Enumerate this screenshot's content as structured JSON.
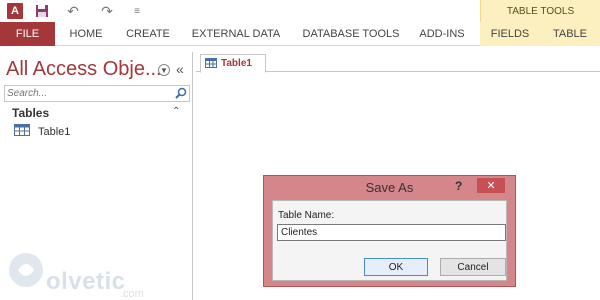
{
  "quick_access": {
    "app_icon_letter": "A",
    "undo_glyph": "↶",
    "redo_glyph": "↷",
    "customize_glyph": "≡"
  },
  "contextual_group": {
    "label": "TABLE TOOLS"
  },
  "ribbon": {
    "tabs": [
      "FILE",
      "HOME",
      "CREATE",
      "EXTERNAL DATA",
      "DATABASE TOOLS",
      "ADD-INS",
      "FIELDS",
      "TABLE"
    ]
  },
  "nav_pane": {
    "title": "All Access Obje...",
    "collapse_glyph": "«",
    "search_placeholder": "Search...",
    "group": {
      "label": "Tables",
      "toggle_glyph": "⌃"
    },
    "items": [
      {
        "label": "Table1"
      }
    ]
  },
  "document": {
    "tab_label": "Table1"
  },
  "dialog": {
    "title": "Save As",
    "help_glyph": "?",
    "close_glyph": "✕",
    "field_label": "Table Name:",
    "field_value": "Clientes",
    "ok_label": "OK",
    "cancel_label": "Cancel"
  },
  "watermark": {
    "text": "olvetic",
    "domain": ".com"
  },
  "colors": {
    "accent": "#a4373a",
    "contextual": "#fdf0c0",
    "dialog_frame": "#d4868a",
    "close_button": "#c75055"
  }
}
